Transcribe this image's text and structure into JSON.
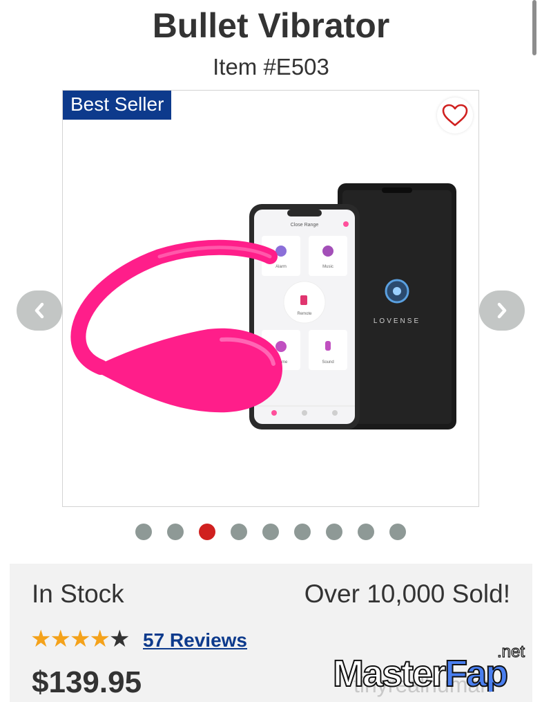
{
  "product": {
    "title": "Bullet Vibrator",
    "item_number": "Item #E503",
    "badge": "Best Seller",
    "app_header": "Close Range",
    "app_tiles": [
      "Alarm",
      "Music",
      "Remote",
      "Theme",
      "Sound"
    ],
    "brand": "LOVENSE"
  },
  "carousel": {
    "slide_count": 9,
    "active_index": 2
  },
  "status": {
    "stock": "In Stock",
    "sold": "Over 10,000 Sold!"
  },
  "rating": {
    "value": 4,
    "max": 5,
    "reviews_label": "57 Reviews"
  },
  "price": "$139.95",
  "watermark": {
    "main_left": "Master",
    "main_right": "Fap",
    "suffix": ".net",
    "sub": "tinyrealhuman"
  },
  "colors": {
    "brand_blue": "#0d3a8c",
    "accent_red": "#d0201f",
    "star": "#f4a21b",
    "product_pink": "#ff1e8a"
  }
}
